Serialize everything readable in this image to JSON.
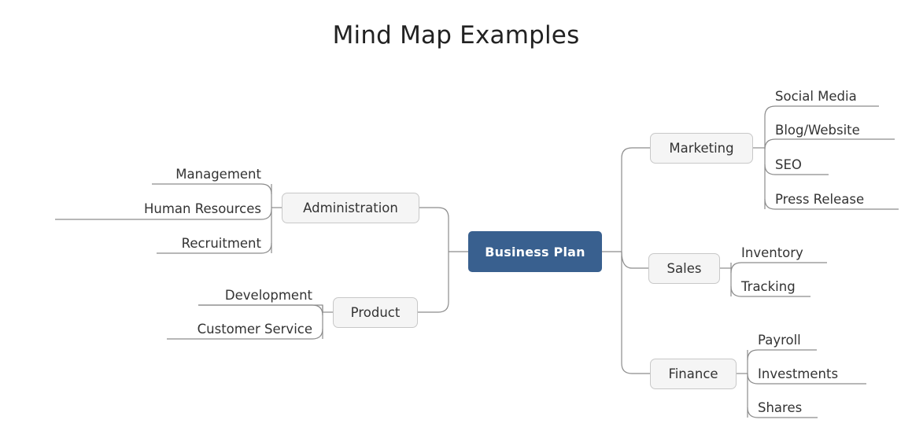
{
  "page": {
    "title": "Mind Map Examples",
    "background_color": "#ffffff"
  },
  "theme": {
    "root_fill": "#39608f",
    "root_text": "#ffffff",
    "branch_fill": "#f5f5f5",
    "branch_border": "#c8c8c8",
    "branch_text": "#333333",
    "connector_color": "#8c8c8c",
    "leaf_underline_color": "#6e6e6e",
    "title_color": "#222222"
  },
  "mindmap": {
    "root": {
      "label": "Business Plan"
    },
    "left_branches": [
      {
        "label": "Administration",
        "leaves": [
          {
            "label": "Management"
          },
          {
            "label": "Human Resources"
          },
          {
            "label": "Recruitment"
          }
        ]
      },
      {
        "label": "Product",
        "leaves": [
          {
            "label": "Development"
          },
          {
            "label": "Customer Service"
          }
        ]
      }
    ],
    "right_branches": [
      {
        "label": "Marketing",
        "leaves": [
          {
            "label": "Social Media"
          },
          {
            "label": "Blog/Website"
          },
          {
            "label": "SEO"
          },
          {
            "label": "Press Release"
          }
        ]
      },
      {
        "label": "Sales",
        "leaves": [
          {
            "label": "Inventory"
          },
          {
            "label": "Tracking"
          }
        ]
      },
      {
        "label": "Finance",
        "leaves": [
          {
            "label": "Payroll"
          },
          {
            "label": "Investments"
          },
          {
            "label": "Shares"
          }
        ]
      }
    ]
  }
}
